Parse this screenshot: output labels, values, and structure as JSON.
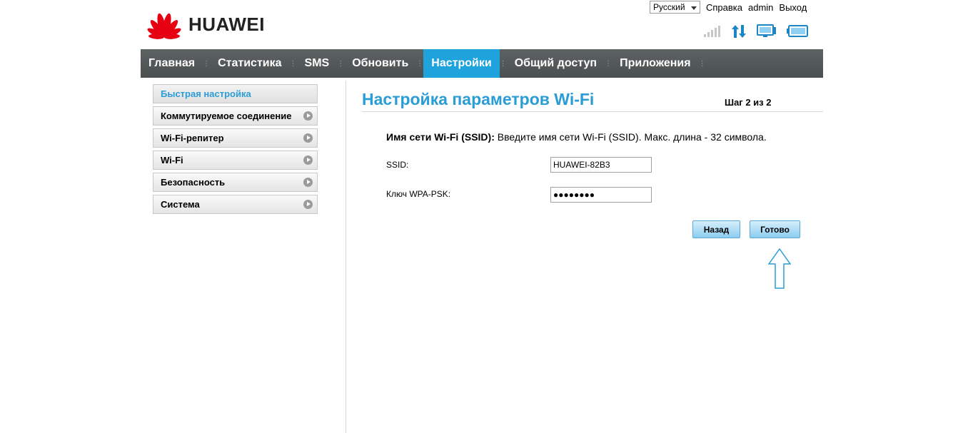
{
  "brand": {
    "name": "HUAWEI",
    "logo_color": "#e60012"
  },
  "topbar": {
    "language": "Русский",
    "help": "Справка",
    "user": "admin",
    "logout": "Выход"
  },
  "status_icons": [
    "signal-icon",
    "data-transfer-icon",
    "monitor-icon",
    "battery-icon"
  ],
  "nav": {
    "items": [
      {
        "label": "Главная"
      },
      {
        "label": "Статистика"
      },
      {
        "label": "SMS"
      },
      {
        "label": "Обновить"
      },
      {
        "label": "Настройки",
        "active": true
      },
      {
        "label": "Общий доступ"
      },
      {
        "label": "Приложения"
      }
    ],
    "active_color": "#1fa3dc"
  },
  "sidebar": {
    "items": [
      {
        "label": "Быстрая настройка",
        "active": true
      },
      {
        "label": "Коммутируемое соединение"
      },
      {
        "label": "Wi-Fi-репитер"
      },
      {
        "label": "Wi-Fi"
      },
      {
        "label": "Безопасность"
      },
      {
        "label": "Система"
      }
    ]
  },
  "main": {
    "title": "Настройка параметров Wi-Fi",
    "step": "Шаг 2 из 2",
    "desc_bold": "Имя сети Wi-Fi (SSID):",
    "desc_text": " Введите имя сети Wi-Fi (SSID). Макс. длина - 32 символа.",
    "ssid_label": "SSID:",
    "ssid_value": "HUAWEI-82B3",
    "wpa_label": "Ключ WPA-PSK:",
    "wpa_value": "●●●●●●●●",
    "back_button": "Назад",
    "done_button": "Готово",
    "accent_color": "#2a9cd6"
  }
}
